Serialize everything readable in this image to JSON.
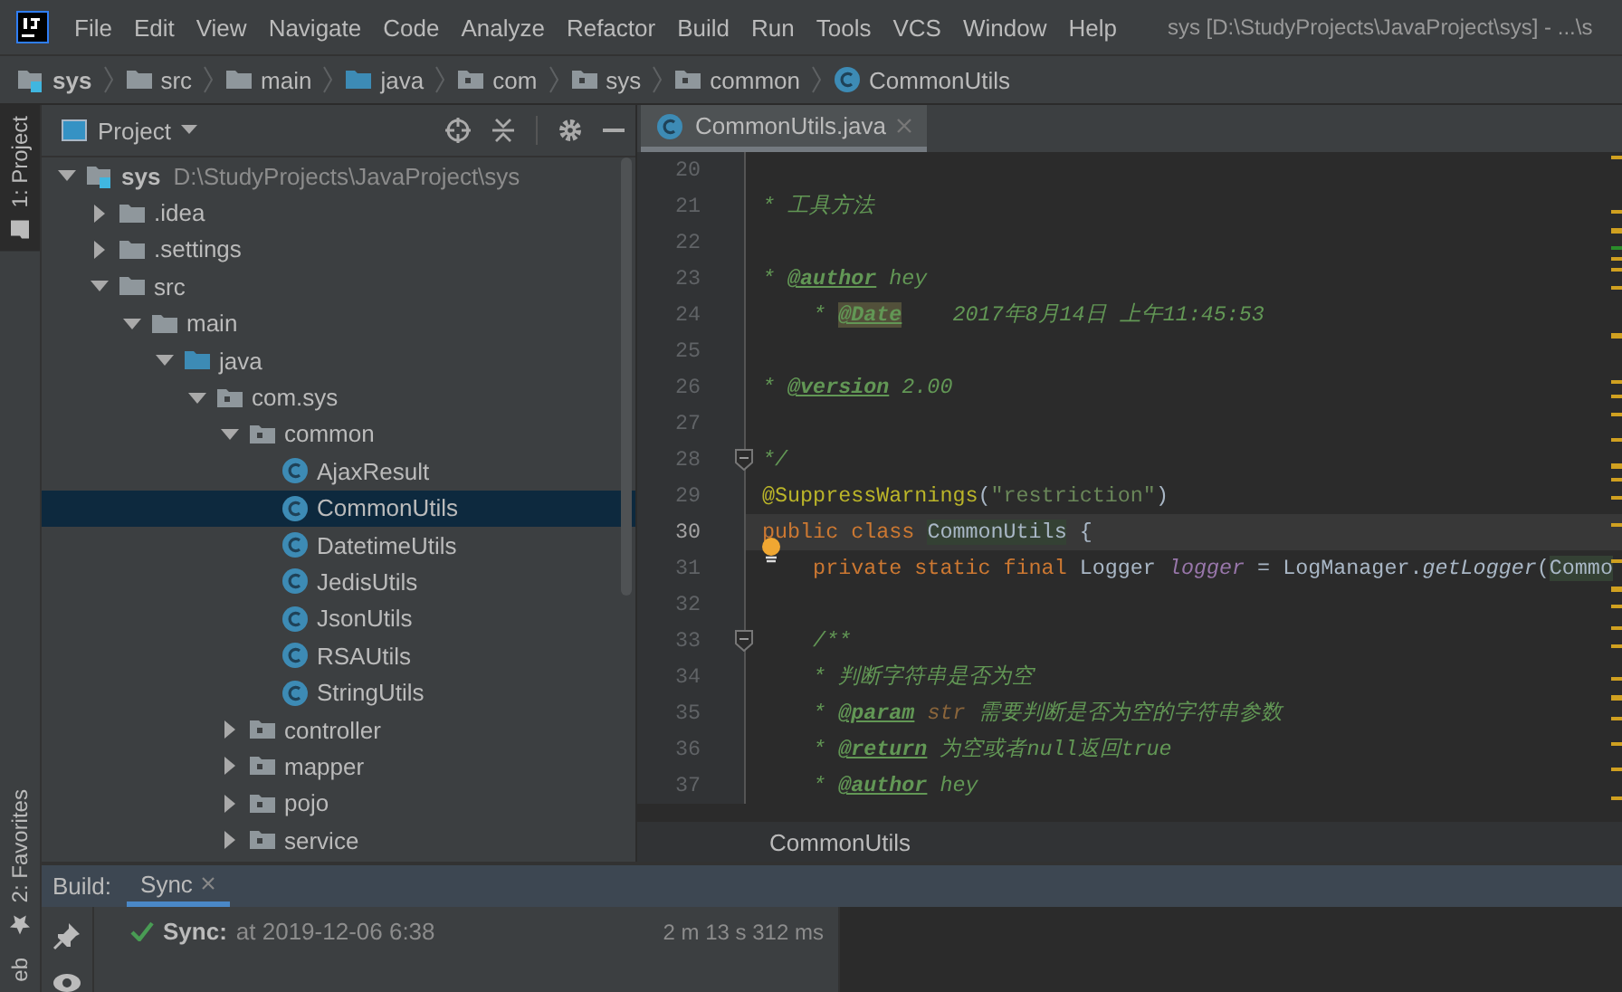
{
  "menu_bar": {
    "items": [
      "File",
      "Edit",
      "View",
      "Navigate",
      "Code",
      "Analyze",
      "Refactor",
      "Build",
      "Run",
      "Tools",
      "VCS",
      "Window",
      "Help"
    ],
    "title": "sys [D:\\StudyProjects\\JavaProject\\sys] - ...\\s"
  },
  "navigation_bar": {
    "crumbs": [
      {
        "label": "sys",
        "kind": "module"
      },
      {
        "label": "src",
        "kind": "folder"
      },
      {
        "label": "main",
        "kind": "folder"
      },
      {
        "label": "java",
        "kind": "source"
      },
      {
        "label": "com",
        "kind": "package"
      },
      {
        "label": "sys",
        "kind": "package"
      },
      {
        "label": "common",
        "kind": "package"
      },
      {
        "label": "CommonUtils",
        "kind": "class"
      }
    ]
  },
  "left_stripe": {
    "top_tabs": [
      {
        "label": "1: Project",
        "selected": true
      }
    ],
    "bottom_tabs": [
      {
        "label": "2: Favorites",
        "selected": false
      },
      {
        "label": "eb",
        "selected": false
      }
    ]
  },
  "project": {
    "title": "Project",
    "tree": [
      {
        "label": "sys",
        "kind": "module",
        "path": "D:\\StudyProjects\\JavaProject\\sys",
        "expanded": true,
        "selected": false,
        "children": [
          {
            "label": ".idea",
            "kind": "folder",
            "expanded": false,
            "selected": false
          },
          {
            "label": ".settings",
            "kind": "folder",
            "expanded": false,
            "selected": false
          },
          {
            "label": "src",
            "kind": "folder",
            "expanded": true,
            "selected": false,
            "children": [
              {
                "label": "main",
                "kind": "folder",
                "expanded": true,
                "selected": false,
                "children": [
                  {
                    "label": "java",
                    "kind": "source",
                    "expanded": true,
                    "selected": false,
                    "children": [
                      {
                        "label": "com.sys",
                        "kind": "package",
                        "expanded": true,
                        "selected": false,
                        "children": [
                          {
                            "label": "common",
                            "kind": "package",
                            "expanded": true,
                            "selected": false,
                            "children": [
                              {
                                "label": "AjaxResult",
                                "kind": "class",
                                "selected": false
                              },
                              {
                                "label": "CommonUtils",
                                "kind": "class",
                                "selected": true
                              },
                              {
                                "label": "DatetimeUtils",
                                "kind": "class",
                                "selected": false
                              },
                              {
                                "label": "JedisUtils",
                                "kind": "class",
                                "selected": false
                              },
                              {
                                "label": "JsonUtils",
                                "kind": "class",
                                "selected": false
                              },
                              {
                                "label": "RSAUtils",
                                "kind": "class",
                                "selected": false
                              },
                              {
                                "label": "StringUtils",
                                "kind": "class",
                                "selected": false
                              }
                            ]
                          },
                          {
                            "label": "controller",
                            "kind": "package",
                            "expanded": false,
                            "selected": false
                          },
                          {
                            "label": "mapper",
                            "kind": "package",
                            "expanded": false,
                            "selected": false
                          },
                          {
                            "label": "pojo",
                            "kind": "package",
                            "expanded": false,
                            "selected": false
                          },
                          {
                            "label": "service",
                            "kind": "package",
                            "expanded": false,
                            "selected": false
                          }
                        ]
                      }
                    ]
                  }
                ]
              }
            ]
          }
        ]
      }
    ]
  },
  "editor": {
    "tabs": [
      {
        "label": "CommonUtils.java",
        "selected": true
      }
    ],
    "lines": [
      {
        "number": "20",
        "current": false
      },
      {
        "number": "21",
        "current": false,
        "tokens": [
          {
            "kind": "doc",
            "text": "* 工具方法"
          }
        ]
      },
      {
        "number": "22",
        "current": false
      },
      {
        "number": "23",
        "current": false,
        "tokens": [
          {
            "kind": "doc",
            "text": "* "
          },
          {
            "kind": "tag",
            "text": "@author"
          },
          {
            "kind": "doc",
            "text": " hey"
          }
        ]
      },
      {
        "number": "24",
        "current": false,
        "tokens": [
          {
            "kind": "doc",
            "text": "    * "
          },
          {
            "kind": "tag_marked",
            "text": "@Date"
          },
          {
            "kind": "doc",
            "text": "    2017年8月14日 上午11:45:53"
          }
        ]
      },
      {
        "number": "25",
        "current": false
      },
      {
        "number": "26",
        "current": false,
        "tokens": [
          {
            "kind": "doc",
            "text": "* "
          },
          {
            "kind": "tag",
            "text": "@version"
          },
          {
            "kind": "doc",
            "text": " 2.00"
          }
        ]
      },
      {
        "number": "27",
        "current": false
      },
      {
        "number": "28",
        "current": false,
        "fold": true,
        "tokens": [
          {
            "kind": "doc",
            "text": "*/"
          }
        ]
      },
      {
        "number": "29",
        "current": false,
        "tokens": [
          {
            "kind": "annotation",
            "text": "@SuppressWarnings"
          },
          {
            "kind": "plain",
            "text": "("
          },
          {
            "kind": "string",
            "text": "\"restriction\""
          },
          {
            "kind": "plain",
            "text": ")"
          }
        ]
      },
      {
        "number": "30",
        "current": true,
        "tokens": [
          {
            "kind": "keyword",
            "text": "public class "
          },
          {
            "kind": "plain_marked",
            "text": "CommonUtils"
          },
          {
            "kind": "plain",
            "text": " {"
          }
        ]
      },
      {
        "number": "31",
        "current": false,
        "bulb": true,
        "tokens": [
          {
            "kind": "keyword",
            "text": "    private static final "
          },
          {
            "kind": "plain",
            "text": "Logger "
          },
          {
            "kind": "field",
            "text": "logger"
          },
          {
            "kind": "plain",
            "text": " = LogManager."
          },
          {
            "kind": "method",
            "text": "getLogger"
          },
          {
            "kind": "plain",
            "text": "("
          },
          {
            "kind": "plain_marked",
            "text": "Commo"
          }
        ]
      },
      {
        "number": "32",
        "current": false
      },
      {
        "number": "33",
        "current": false,
        "fold": true,
        "tokens": [
          {
            "kind": "doc",
            "text": "    /**"
          }
        ]
      },
      {
        "number": "34",
        "current": false,
        "tokens": [
          {
            "kind": "doc",
            "text": "    * 判断字符串是否为空"
          }
        ]
      },
      {
        "number": "35",
        "current": false,
        "tokens": [
          {
            "kind": "doc",
            "text": "    * "
          },
          {
            "kind": "tag",
            "text": "@param"
          },
          {
            "kind": "param",
            "text": " str"
          },
          {
            "kind": "doc",
            "text": " 需要判断是否为空的字符串参数"
          }
        ]
      },
      {
        "number": "36",
        "current": false,
        "tokens": [
          {
            "kind": "doc",
            "text": "    * "
          },
          {
            "kind": "tag",
            "text": "@return"
          },
          {
            "kind": "doc",
            "text": " 为空或者null返回true"
          }
        ]
      },
      {
        "number": "37",
        "current": false,
        "tokens": [
          {
            "kind": "doc",
            "text": "    * "
          },
          {
            "kind": "tag",
            "text": "@author"
          },
          {
            "kind": "doc",
            "text": " hey"
          }
        ]
      }
    ],
    "breadcrumb": "CommonUtils"
  },
  "build": {
    "label": "Build:",
    "tabs": [
      {
        "label": "Sync",
        "selected": true
      }
    ],
    "entries": [
      {
        "succeeded": true,
        "title": "Sync:",
        "detail": "at 2019-12-06 6:38",
        "duration": "2 m 13 s 312 ms"
      }
    ]
  }
}
